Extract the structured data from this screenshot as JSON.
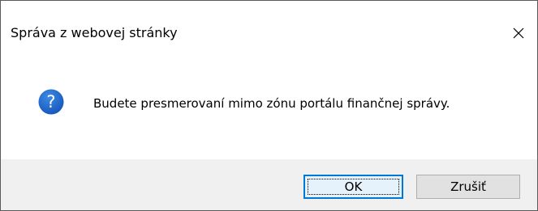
{
  "dialog": {
    "title": "Správa z webovej stránky",
    "message": "Budete presmerovaní mimo zónu portálu finančnej správy.",
    "icon": "question-icon",
    "accent_color": "#0078d7",
    "icon_color": "#1c67c9"
  },
  "buttons": {
    "ok_label": "OK",
    "cancel_label": "Zrušiť"
  }
}
